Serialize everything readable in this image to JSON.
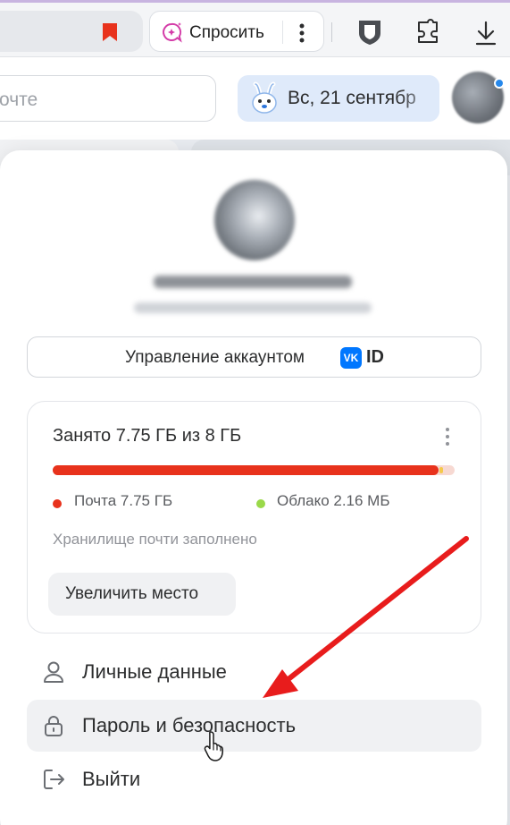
{
  "browser": {
    "ask_label": "Спросить",
    "icons": [
      "bookmark-icon",
      "ask-sparkle-icon",
      "more-vertical-icon",
      "shield-icon",
      "extensions-icon",
      "download-icon"
    ],
    "accent_color": "#c8b4e0"
  },
  "header": {
    "search_placeholder": "очте",
    "date_label": "Вс, 21 сентябр"
  },
  "profile": {
    "manage_account_label": "Управление аккаунтом",
    "vk_logo_text": "VK",
    "vk_id_label": "ID"
  },
  "storage": {
    "title": "Занято 7.75 ГБ из 8 ГБ",
    "used_fraction": 0.96,
    "legend": [
      {
        "label": "Почта 7.75 ГБ",
        "color": "#e8321c"
      },
      {
        "label": "Облако 2.16 МБ",
        "color": "#9ad94a"
      }
    ],
    "warning": "Хранилище почти заполнено",
    "increase_label": "Увеличить место"
  },
  "menu": {
    "items": [
      {
        "label": "Личные данные",
        "icon": "user-icon"
      },
      {
        "label": "Пароль и безопасность",
        "icon": "lock-icon"
      },
      {
        "label": "Выйти",
        "icon": "logout-icon"
      }
    ]
  },
  "annotation": {
    "arrow_color": "#e81c1c"
  }
}
